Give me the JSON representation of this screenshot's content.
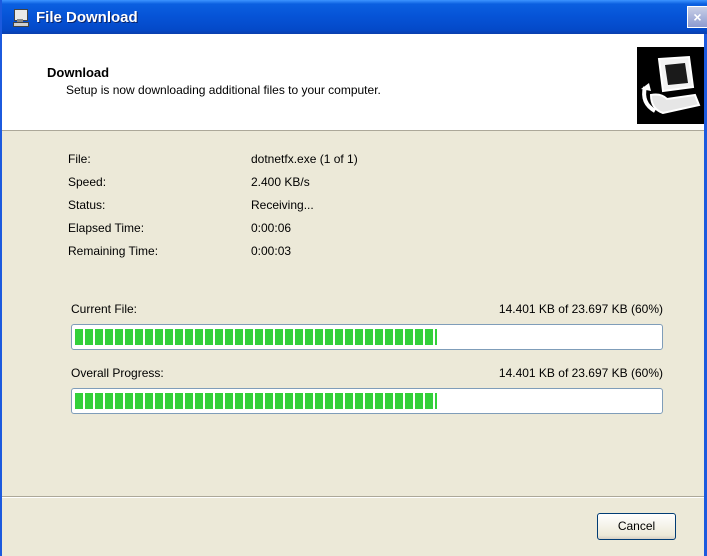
{
  "window": {
    "title": "File Download",
    "close_glyph": "×"
  },
  "header": {
    "title": "Download",
    "subtitle": "Setup is now downloading additional files to your computer."
  },
  "details": {
    "file_label": "File:",
    "file_value": "dotnetfx.exe (1 of 1)",
    "speed_label": "Speed:",
    "speed_value": "2.400 KB/s",
    "status_label": "Status:",
    "status_value": "Receiving...",
    "elapsed_label": "Elapsed Time:",
    "elapsed_value": "0:00:06",
    "remaining_label": "Remaining Time:",
    "remaining_value": "0:00:03"
  },
  "current_file": {
    "label": "Current File:",
    "amount": "14.401 KB of 23.697 KB (60%)",
    "progress": 0.62
  },
  "overall": {
    "label": "Overall Progress:",
    "amount": "14.401 KB of 23.697 KB (60%)",
    "progress": 0.62
  },
  "buttons": {
    "cancel": "Cancel"
  },
  "icons": {
    "title_icon": "computer-icon",
    "header_graphic": "download-computer-icon"
  },
  "colors": {
    "titlebar": "#0653d6",
    "progress_fill": "#33d03a",
    "dialog_bg": "#ece9d8"
  }
}
